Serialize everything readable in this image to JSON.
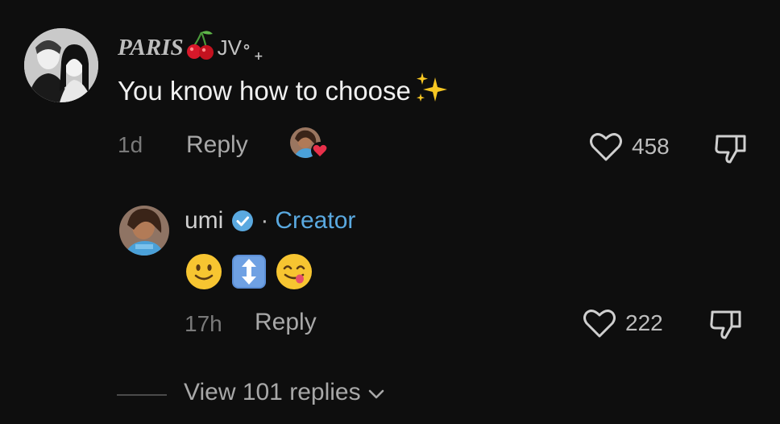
{
  "comment": {
    "username": "PARIS",
    "username_suffix": "JV",
    "username_dot": "°",
    "username_sparkle": "+",
    "cherry_icon": "cherry-emoji-icon",
    "text": "You know how to choose",
    "text_emoji": "sparkles-emoji-icon",
    "time": "1d",
    "reply_label": "Reply",
    "likes": "458",
    "liked_by_creator": true
  },
  "reply": {
    "username": "umi",
    "verified": true,
    "separator": "·",
    "badge_label": "Creator",
    "emojis": [
      "slightly-smiling-face-emoji",
      "up-down-arrow-emoji",
      "face-savoring-food-emoji"
    ],
    "time": "17h",
    "reply_label": "Reply",
    "likes": "222"
  },
  "thread": {
    "view_replies_label": "View 101 replies"
  },
  "colors": {
    "background": "#0e0e0e",
    "creator_blue": "#5aa9e0",
    "heart_red": "#e8304a",
    "muted_text": "#7a7a7a"
  }
}
